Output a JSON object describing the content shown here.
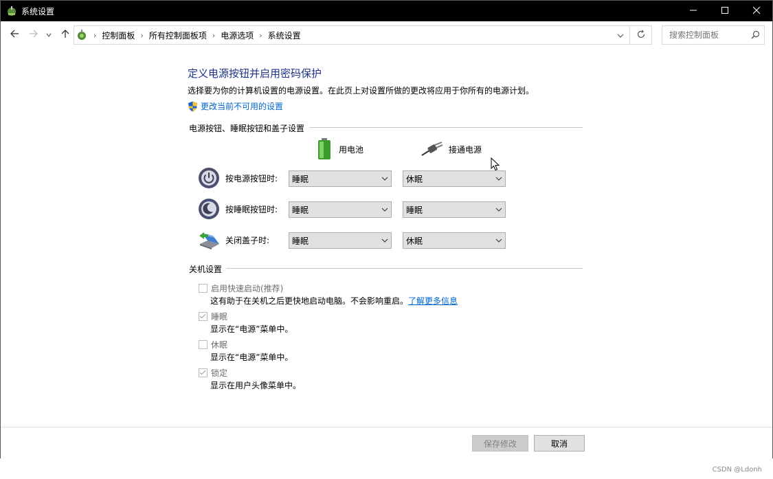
{
  "window": {
    "title": "系统设置",
    "minimize_icon": "minimize-icon",
    "maximize_icon": "maximize-icon",
    "close_icon": "close-icon"
  },
  "address": {
    "breadcrumbs": [
      "控制面板",
      "所有控制面板项",
      "电源选项",
      "系统设置"
    ],
    "search_placeholder": "搜索控制面板"
  },
  "main": {
    "title": "定义电源按钮并启用密码保护",
    "description": "选择要为你的计算机设置的电源设置。在此页上对设置所做的更改将应用于你所有的电源计划。",
    "change_unavailable_link": "更改当前不可用的设置",
    "power_section": {
      "heading": "电源按钮、睡眠按钮和盖子设置",
      "col_battery": "用电池",
      "col_plugged": "接通电源",
      "rows": [
        {
          "label": "按电源按钮时:",
          "battery": "睡眠",
          "plugged": "休眠"
        },
        {
          "label": "按睡眠按钮时:",
          "battery": "睡眠",
          "plugged": "睡眠"
        },
        {
          "label": "关闭盖子时:",
          "battery": "睡眠",
          "plugged": "休眠"
        }
      ]
    },
    "shutdown_section": {
      "heading": "关机设置",
      "items": [
        {
          "label": "启用快速启动(推荐)",
          "checked": false,
          "desc": "这有助于在关机之后更快地启动电脑。不会影响重启。",
          "link": "了解更多信息"
        },
        {
          "label": "睡眠",
          "checked": true,
          "desc": "显示在“电源”菜单中。"
        },
        {
          "label": "休眠",
          "checked": false,
          "desc": "显示在“电源”菜单中。"
        },
        {
          "label": "锁定",
          "checked": true,
          "desc": "显示在用户头像菜单中。"
        }
      ]
    }
  },
  "footer": {
    "save_label": "保存修改",
    "cancel_label": "取消"
  },
  "watermark": "CSDN @Ldonh",
  "colors": {
    "title_blue": "#1e3287",
    "link_blue": "#0066cc",
    "titlebar": "#000000"
  }
}
